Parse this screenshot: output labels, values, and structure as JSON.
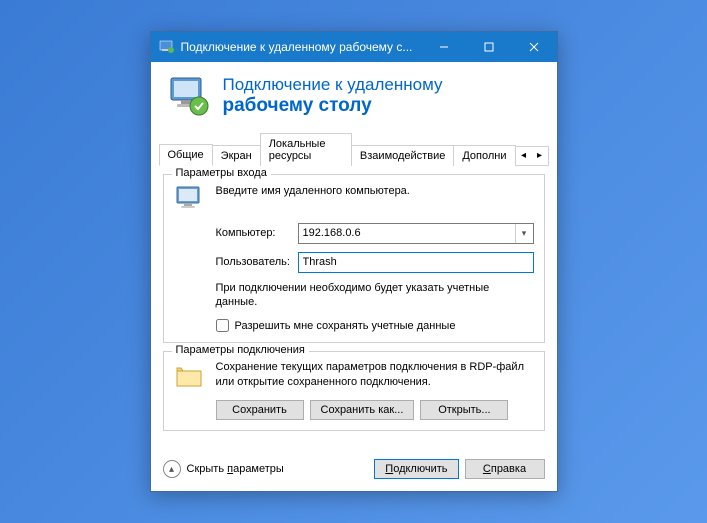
{
  "titlebar": {
    "text": "Подключение к удаленному рабочему с..."
  },
  "header": {
    "line1": "Подключение к удаленному",
    "line2": "рабочему столу"
  },
  "tabs": {
    "items": [
      {
        "label": "Общие"
      },
      {
        "label": "Экран"
      },
      {
        "label": "Локальные ресурсы"
      },
      {
        "label": "Взаимодействие"
      },
      {
        "label": "Дополни"
      }
    ]
  },
  "login_group": {
    "title": "Параметры входа",
    "instruction": "Введите имя удаленного компьютера.",
    "computer_label": "Компьютер:",
    "computer_value": "192.168.0.6",
    "user_label": "Пользователь:",
    "user_value": "Thrash",
    "note": "При подключении необходимо будет указать учетные данные.",
    "checkbox_label": "Разрешить мне сохранять учетные данные"
  },
  "conn_group": {
    "title": "Параметры подключения",
    "text": "Сохранение текущих параметров подключения в RDP-файл или открытие сохраненного подключения.",
    "save": "Сохранить",
    "save_as": "Сохранить как...",
    "open": "Открыть..."
  },
  "footer": {
    "hide": "Скрыть параметры",
    "hide_u": "п",
    "connect": "Подключить",
    "connect_u": "П",
    "help": "Справка",
    "help_u": "С"
  }
}
